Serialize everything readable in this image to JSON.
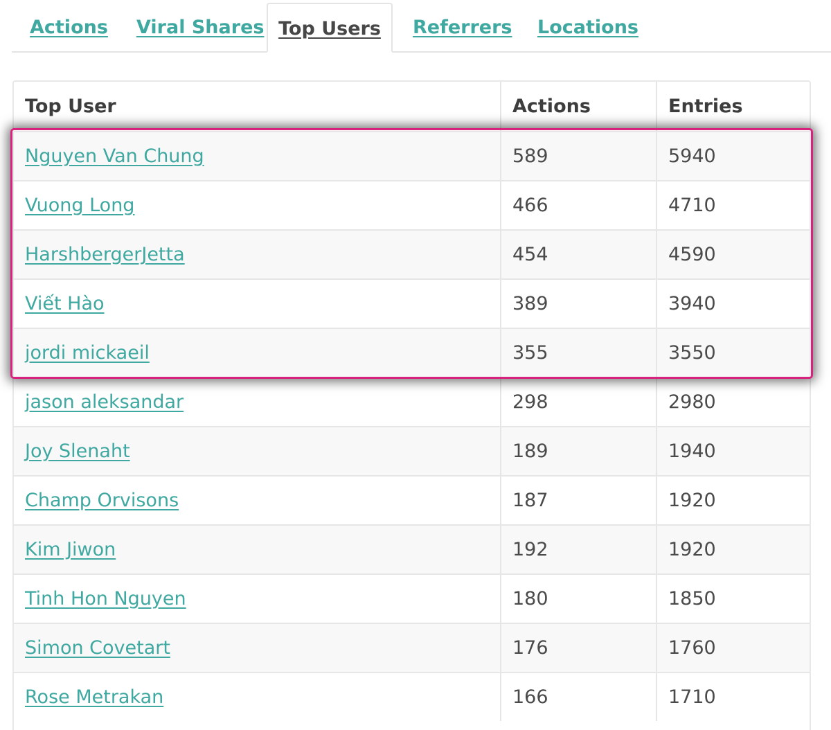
{
  "tabs": [
    {
      "label": "Actions",
      "active": false
    },
    {
      "label": "Viral Shares",
      "active": false
    },
    {
      "label": "Top Users",
      "active": true
    },
    {
      "label": "Referrers",
      "active": false
    },
    {
      "label": "Locations",
      "active": false
    }
  ],
  "table": {
    "headers": [
      "Top User",
      "Actions",
      "Entries"
    ],
    "rows": [
      {
        "user": "Nguyen Van Chung",
        "actions": "589",
        "entries": "5940"
      },
      {
        "user": "Vuong Long",
        "actions": "466",
        "entries": "4710"
      },
      {
        "user": "HarshbergerJetta",
        "actions": "454",
        "entries": "4590"
      },
      {
        "user": "Viết Hào",
        "actions": "389",
        "entries": "3940"
      },
      {
        "user": "jordi mickaeil",
        "actions": "355",
        "entries": "3550"
      },
      {
        "user": "jason aleksandar",
        "actions": "298",
        "entries": "2980"
      },
      {
        "user": "Joy Slenaht",
        "actions": "189",
        "entries": "1940"
      },
      {
        "user": "Champ Orvisons",
        "actions": "187",
        "entries": "1920"
      },
      {
        "user": "Kim Jiwon",
        "actions": "192",
        "entries": "1920"
      },
      {
        "user": "Tinh Hon Nguyen",
        "actions": "180",
        "entries": "1850"
      },
      {
        "user": "Simon Covetart",
        "actions": "176",
        "entries": "1760"
      },
      {
        "user": "Rose Metrakan",
        "actions": "166",
        "entries": "1710"
      }
    ],
    "highlighted_rows": 5
  },
  "colors": {
    "link": "#3fa8a0",
    "highlight_border": "#d6247e",
    "active_tab_text": "#474747"
  }
}
